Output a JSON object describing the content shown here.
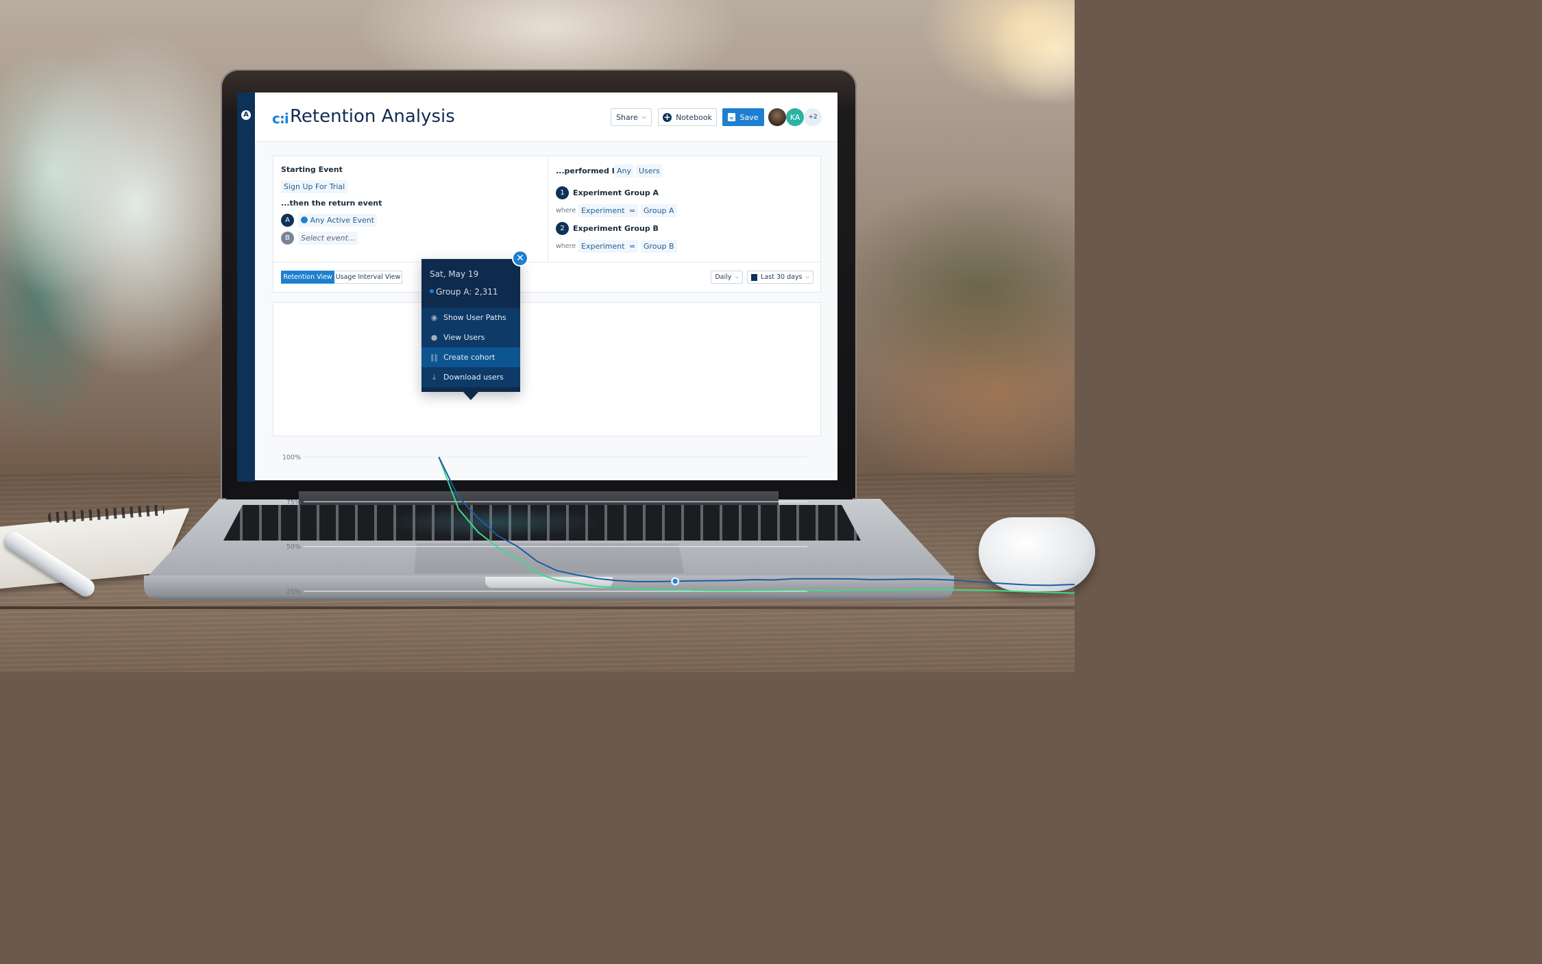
{
  "app": {
    "sidebar_logo_icon": "amplitude-logo-icon",
    "title_icon": "retention-icon",
    "title": "Retention Analysis",
    "header_buttons": {
      "share": "Share",
      "notebook": "Notebook",
      "save": "Save"
    },
    "collaborators": [
      {
        "type": "photo",
        "label": ""
      },
      {
        "type": "initials",
        "label": "KA",
        "color": "#2bb3a3"
      },
      {
        "type": "overflow",
        "label": "+2"
      }
    ]
  },
  "query": {
    "starting_event_label": "Starting Event",
    "starting_event": "Sign Up For Trial",
    "return_event_label": "...then the return event",
    "return_events": [
      {
        "badge": "A",
        "value": "Any Active Event",
        "icon": "amplitude-event-icon"
      },
      {
        "badge": "B",
        "value": "Select event...",
        "placeholder": true
      }
    ],
    "performed_by_label": "...performed by",
    "performed_by": [
      "Any",
      "Users"
    ],
    "segments": [
      {
        "index": "1",
        "name": "Experiment Group A",
        "where": "where",
        "property": "Experiment",
        "operator": "=",
        "value": "Group A"
      },
      {
        "index": "2",
        "name": "Experiment Group B",
        "where": "where",
        "property": "Experiment",
        "operator": "=",
        "value": "Group B"
      }
    ]
  },
  "controls": {
    "views": [
      {
        "label": "Retention View",
        "active": true
      },
      {
        "label": "Usage Interval View",
        "active": false
      }
    ],
    "interval": "Daily",
    "date_range": "Last 30 days",
    "date_range_icon": "calendar-icon"
  },
  "tooltip": {
    "date": "Sat, May 19",
    "series_label": "Group A: 2,311",
    "close_icon": "close-icon",
    "menu": [
      {
        "label": "Show User Paths",
        "icon": "eye-icon",
        "active": false
      },
      {
        "label": "View Users",
        "icon": "user-icon",
        "active": false
      },
      {
        "label": "Create cohort",
        "icon": "cohort-icon",
        "active": true
      },
      {
        "label": "Download users",
        "icon": "download-icon",
        "active": false
      }
    ]
  },
  "chart_data": {
    "type": "line",
    "title": "",
    "xlabel": "",
    "ylabel": "",
    "y_ticks": [
      "25%",
      "50%",
      "75%",
      "100%"
    ],
    "y_tick_values": [
      25,
      50,
      75,
      100
    ],
    "ylim": [
      25,
      100
    ],
    "grid": true,
    "x": [
      0,
      1,
      2,
      3,
      4,
      5,
      6,
      7,
      8,
      9,
      10,
      11,
      12,
      13,
      14,
      15,
      16,
      17,
      18,
      19,
      20,
      21,
      22,
      23,
      24,
      25,
      26,
      27,
      28,
      29,
      30,
      31,
      32,
      33,
      34,
      35
    ],
    "highlight_index": 12,
    "series": [
      {
        "name": "Experiment Group A",
        "color": "#1f5aa6",
        "values": [
          100,
          77.5,
          66,
          56,
          50,
          41.7,
          36.5,
          34.1,
          32.2,
          31.0,
          30.4,
          30.4,
          30.6,
          30.8,
          30.9,
          31.1,
          31.5,
          31.3,
          32.0,
          32.0,
          32.0,
          31.9,
          31.5,
          31.6,
          31.8,
          31.7,
          31.3,
          30.5,
          29.8,
          29.1,
          28.5,
          28.3,
          28.7,
          29.1,
          29.2,
          29.3
        ]
      },
      {
        "name": "Experiment Group B",
        "color": "#3fd98f",
        "values": [
          100,
          71,
          58,
          49.5,
          43.5,
          35,
          31.2,
          29.5,
          27.8,
          27.0,
          26.4,
          26.0,
          25.8,
          25.5,
          25.4,
          25.4,
          25.5,
          25.5,
          25.6,
          25.5,
          25.3,
          25.9,
          25.6,
          25.6,
          25.8,
          25.9,
          25.9,
          25.7,
          25.5,
          25.1,
          24.7,
          24.4,
          24.1,
          23.9,
          24.1,
          24.0
        ]
      }
    ]
  }
}
